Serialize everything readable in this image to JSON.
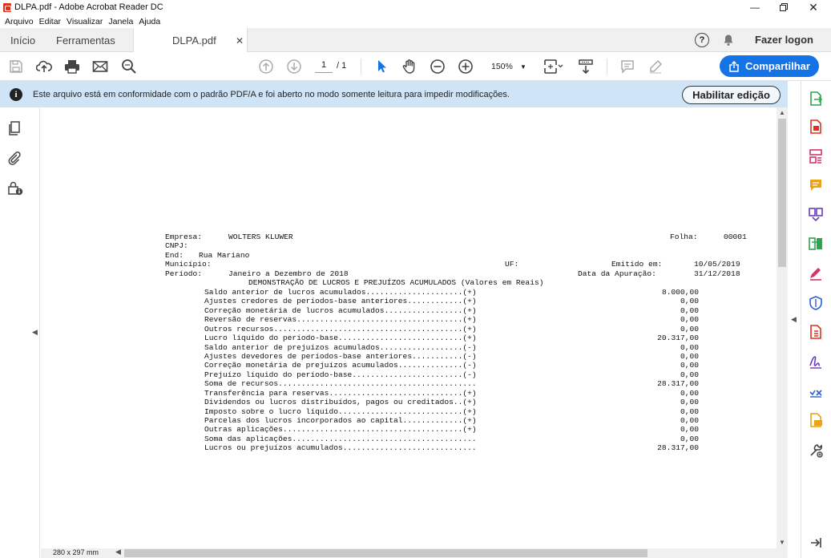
{
  "window": {
    "title": "DLPA.pdf - Adobe Acrobat Reader DC"
  },
  "menu": [
    "Arquivo",
    "Editar",
    "Visualizar",
    "Janela",
    "Ajuda"
  ],
  "tabs": {
    "home": "Início",
    "tools": "Ferramentas",
    "doc": "DLPA.pdf"
  },
  "header": {
    "login": "Fazer logon",
    "help": "?"
  },
  "toolbar": {
    "page_current": "1",
    "page_total": "/ 1",
    "zoom": "150%",
    "share": "Compartilhar"
  },
  "infobar": {
    "message": "Este arquivo está em conformidade com o padrão PDF/A e foi aberto no modo somente leitura para impedir modificações.",
    "enable_edit": "Habilitar edição"
  },
  "status": {
    "page_size": "280 x 297 mm"
  },
  "document": {
    "empresa_label": "Empresa:",
    "empresa": "WOLTERS KLUWER",
    "folha_label": "Folha:",
    "folha": "00001",
    "cnpj_label": "CNPJ:",
    "end_label": "End:",
    "end": "Rua Mariano",
    "municipio_label": "Município:",
    "uf_label": "UF:",
    "emitido_label": "Emitido em:",
    "emitido": "10/05/2019",
    "periodo_label": "Período:",
    "periodo": "Janeiro a Dezembro de 2018",
    "apuracao_label": "Data da Apuração:",
    "apuracao": "31/12/2018",
    "title": "DEMONSTRAÇÃO DE LUCROS E PREJUÍZOS ACUMULADOS (Valores em Reais)",
    "rows": [
      {
        "label": "Saldo anterior de lucros acumulados.....................(+)",
        "value": "8.000,00"
      },
      {
        "label": "Ajustes credores de períodos-base anteriores............(+)",
        "value": "0,00"
      },
      {
        "label": "Correção monetária de lucros acumulados.................(+)",
        "value": "0,00"
      },
      {
        "label": "Reversão de reservas....................................(+)",
        "value": "0,00"
      },
      {
        "label": "Outros recursos.........................................(+)",
        "value": "0,00"
      },
      {
        "label": "Lucro líquido do período-base...........................(+)",
        "value": "20.317,00"
      },
      {
        "label": "Saldo anterior de prejuízos acumulados..................(-)",
        "value": "0,00"
      },
      {
        "label": "Ajustes devedores de períodos-base anteriores...........(-)",
        "value": "0,00"
      },
      {
        "label": "Correção monetária de prejuízos acumulados..............(-)",
        "value": "0,00"
      },
      {
        "label": "Prejuízo líquido do período-base........................(-)",
        "value": "0,00"
      },
      {
        "label": "Soma de recursos...........................................",
        "value": "28.317,00"
      },
      {
        "label": "Transferência para reservas.............................(+)",
        "value": "0,00"
      },
      {
        "label": "Dividendos ou lucros distribuídos, pagos ou creditados..(+)",
        "value": "0,00"
      },
      {
        "label": "Imposto sobre o lucro líquido...........................(+)",
        "value": "0,00"
      },
      {
        "label": "Parcelas dos lucros incorporados ao capital.............(+)",
        "value": "0,00"
      },
      {
        "label": "Outras aplicações.......................................(+)",
        "value": "0,00"
      },
      {
        "label": "Soma das aplicações........................................",
        "value": "0,00"
      },
      {
        "label": "Lucros ou prejuízos acumulados.............................",
        "value": "28.317,00"
      }
    ]
  },
  "colors": {
    "accent": "#1473e6",
    "infobar": "#cfe4f7",
    "tool_red": "#e0311e",
    "tool_pink": "#d6336c",
    "tool_yellow": "#e8a317",
    "tool_purple": "#6a3dbd",
    "tool_green": "#2da44e",
    "tool_blue": "#2d5fd3"
  }
}
